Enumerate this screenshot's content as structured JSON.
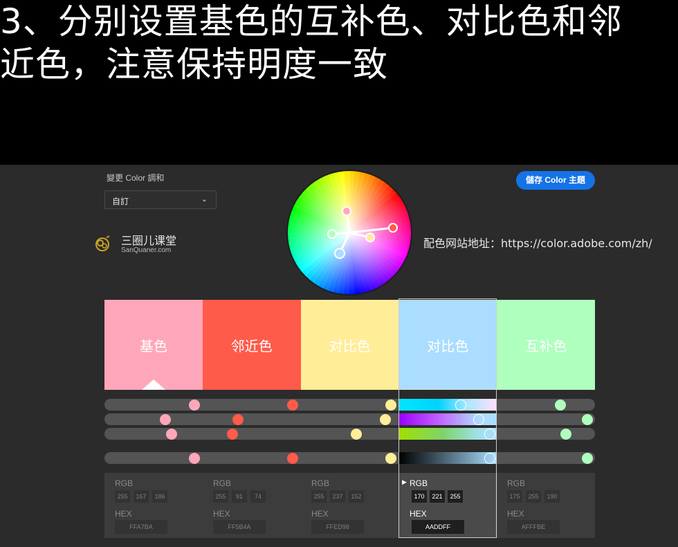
{
  "headline": {
    "line1": "3、分别设置基色的互补色、对比色和邻",
    "line2": "近色，注意保持明度一致"
  },
  "toolbar": {
    "mode_label": "變更 Color 調和",
    "mode_value": "自訂",
    "save_label": "儲存 Color 主題"
  },
  "brand": {
    "name": "三圈儿课堂",
    "sub": "SanQuaner.com"
  },
  "site_url": "配色网站地址：https://color.adobe.com/zh/",
  "swatches": [
    {
      "label": "基色",
      "color": "#FFA7BA"
    },
    {
      "label": "邻近色",
      "color": "#FF5B4A"
    },
    {
      "label": "对比色",
      "color": "#FFED98"
    },
    {
      "label": "对比色",
      "color": "#AADDFF"
    },
    {
      "label": "互补色",
      "color": "#AFFFBE"
    }
  ],
  "colors": [
    {
      "rgb": [
        "255",
        "167",
        "186"
      ],
      "hex": "FFA7BA"
    },
    {
      "rgb": [
        "255",
        "91",
        "74"
      ],
      "hex": "FF5B4A"
    },
    {
      "rgb": [
        "255",
        "237",
        "152"
      ],
      "hex": "FFED98"
    },
    {
      "rgb": [
        "170",
        "221",
        "255"
      ],
      "hex": "AADDFF"
    },
    {
      "rgb": [
        "175",
        "255",
        "190"
      ],
      "hex": "AFFFBE"
    }
  ],
  "panel": {
    "rgb_label": "RGB",
    "hex_label": "HEX"
  },
  "selected_index": 3
}
